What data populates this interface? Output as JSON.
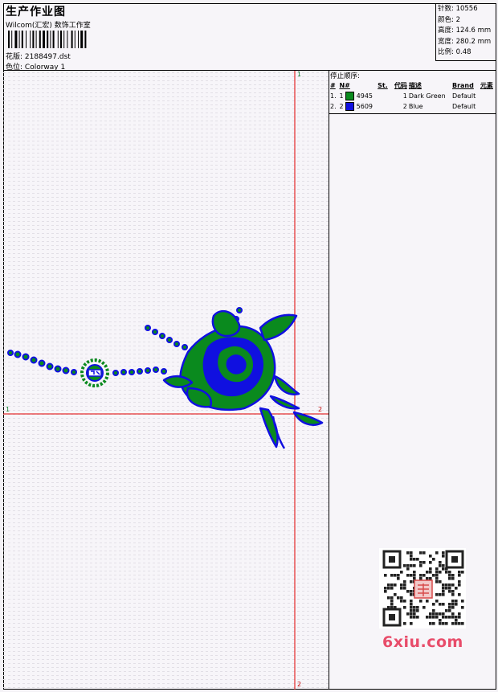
{
  "header": {
    "title": "生产作业图",
    "company": "Wilcom(汇宏) 数饰工作室",
    "design_label": "花版:",
    "design_value": "2188497.dst",
    "colorway_label": "色位:",
    "colorway_value": "Colorway 1"
  },
  "stats": {
    "stitches_label": "针数:",
    "stitches_value": "10556",
    "colors_label": "颜色:",
    "colors_value": "2",
    "height_label": "高度:",
    "height_value": "124.6 mm",
    "width_label": "宽度:",
    "width_value": "280.2 mm",
    "scale_label": "比例:",
    "scale_value": "0.48"
  },
  "stop_sequence": {
    "title": "停止顺序:",
    "columns": [
      "#",
      "N#",
      "St.",
      "代码",
      "描述",
      "Brand",
      "元素"
    ],
    "rows": [
      {
        "num": "1.",
        "n": "1",
        "color": "#0a8a1e",
        "st": "4945",
        "code": "1",
        "desc": "Dark Green",
        "brand": "Default"
      },
      {
        "num": "2.",
        "n": "2",
        "color": "#1010e0",
        "st": "5609",
        "code": "2",
        "desc": "Blue",
        "brand": "Default"
      }
    ]
  },
  "axes": {
    "v_top": "1",
    "v_bottom": "2",
    "h_left": "1",
    "h_right": "2"
  },
  "watermark": "6xiu.com",
  "colors": {
    "thread_green": "#0a8a1e",
    "thread_blue": "#1010e0",
    "guide_red": "#e00000",
    "guide_green": "#0a7a2a"
  }
}
